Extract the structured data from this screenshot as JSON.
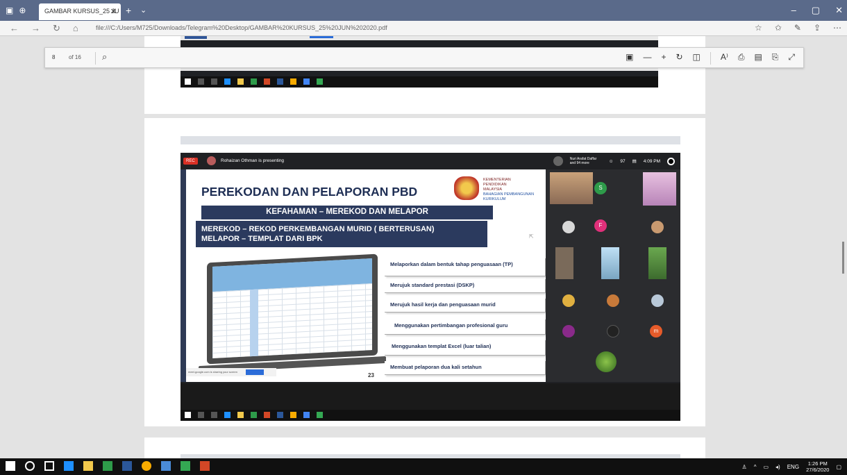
{
  "browser": {
    "tab_title": "GAMBAR KURSUS_25 JU",
    "url": "file:///C:/Users/M725/Downloads/Telegram%20Desktop/GAMBAR%20KURSUS_25%20JUN%202020.pdf"
  },
  "pdf_toolbar": {
    "page_number": "8",
    "page_of": "of 16"
  },
  "meet": {
    "rec_label": "REC",
    "presenting_text": "Rohaizan Othman is presenting",
    "participants_label": "Nuri Arafat Daffar and 94 more",
    "participant_count": "97",
    "time": "4:09 PM"
  },
  "slide": {
    "title": "PEREKODAN DAN PELAPORAN PBD",
    "org_name": "KEMENTERIAN PENDIDIKAN MALAYSIA",
    "org_sub": "BAHAGIAN PEMBANGUNAN KURIKULUM",
    "subhead": "KEFAHAMAN – MEREKOD DAN MELAPOR",
    "def_line1": "MEREKOD – REKOD PERKEMBANGAN MURID ( BERTERUSAN)",
    "def_line2": "MELAPOR – TEMPLAT DARI BPK",
    "points": [
      "Melaporkan dalam bentuk tahap penguasaan (TP)",
      "Merujuk standard prestasi (DSKP)",
      "Merujuk hasil kerja dan penguasaan murid",
      "Menggunakan pertimbangan profesional guru",
      "Menggunakan templat Excel (luar talian)",
      "Membuat pelaporan dua kali setahun"
    ],
    "slide_number": "23",
    "sharing_text": "meet.google.com is sharing your screen",
    "stop_sharing": "Stop sharing",
    "hide": "Hide"
  },
  "tiles": {
    "s": "S",
    "f": "F",
    "m": "m",
    "presenter_name": "Rohaizan Othman"
  },
  "taskbar": {
    "lang": "ENG",
    "time": "1:26 PM",
    "date": "27/6/2020"
  },
  "colors": {
    "slide_navy": "#2b3a5e",
    "title_navy": "#1f2f55",
    "rec_red": "#d93025"
  }
}
